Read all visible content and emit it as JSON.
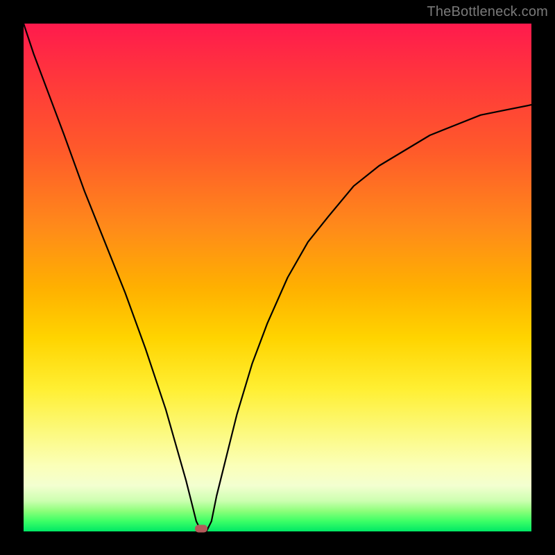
{
  "watermark": "TheBottleneck.com",
  "colors": {
    "frame": "#000000",
    "gradient_top": "#ff1a4d",
    "gradient_bottom": "#00e865",
    "curve": "#000000",
    "marker": "#b35a5a",
    "watermark_text": "#7a7a7a"
  },
  "chart_data": {
    "type": "line",
    "title": "",
    "xlabel": "",
    "ylabel": "",
    "xlim": [
      0,
      100
    ],
    "ylim": [
      0,
      100
    ],
    "grid": false,
    "legend": false,
    "series": [
      {
        "name": "bottleneck-curve",
        "x": [
          0,
          2,
          5,
          8,
          12,
          16,
          20,
          24,
          28,
          30,
          32,
          33,
          34,
          35,
          36,
          37,
          38,
          40,
          42,
          45,
          48,
          52,
          56,
          60,
          65,
          70,
          75,
          80,
          85,
          90,
          95,
          100
        ],
        "y": [
          100,
          94,
          86,
          78,
          67,
          57,
          47,
          36,
          24,
          17,
          10,
          6,
          2,
          0,
          0,
          2,
          7,
          15,
          23,
          33,
          41,
          50,
          57,
          62,
          68,
          72,
          75,
          78,
          80,
          82,
          83,
          84
        ]
      }
    ],
    "annotations": [
      {
        "name": "optimal-marker",
        "x": 35,
        "y": 0
      }
    ],
    "notes": "V-shaped bottleneck curve. Minimum (best match) at x≈35 where curve touches y=0. Left branch descends steeply from top-left; right branch rises with diminishing slope toward ~84 at x=100. Background gradient encodes severity: red (high) at top to green (low) at bottom."
  }
}
